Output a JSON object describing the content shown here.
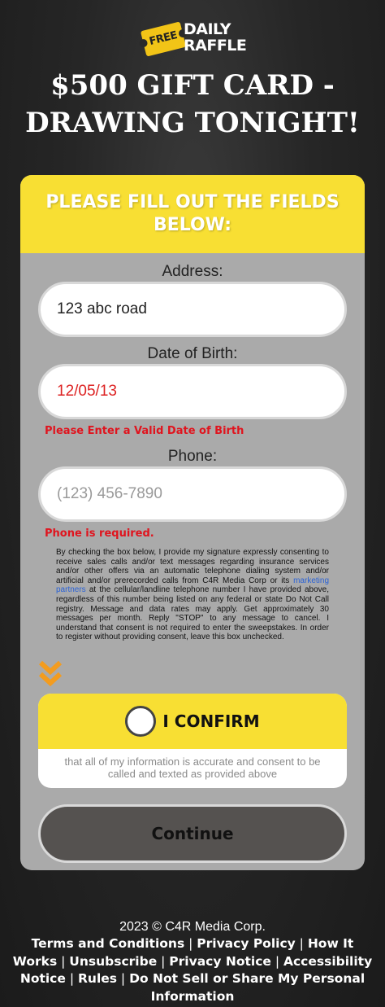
{
  "logo": {
    "free": "FREE",
    "line1": "DAILY",
    "line2": "RAFFLE"
  },
  "headline": {
    "line1": "$500 GIFT CARD -",
    "line2": "DRAWING TONIGHT!"
  },
  "form": {
    "header": "PLEASE FILL OUT THE FIELDS BELOW:",
    "address": {
      "label": "Address:",
      "value": "123 abc road"
    },
    "dob": {
      "label": "Date of Birth:",
      "value": "12/05/13",
      "error": "Please Enter a Valid Date of Birth"
    },
    "phone": {
      "label": "Phone:",
      "value": "",
      "placeholder": "(123) 456-7890",
      "error": "Phone is required."
    },
    "consent": {
      "before": "By checking the box below, I provide my signature expressly consenting to receive sales calls and/or text messages regarding insurance services and/or other offers via an automatic telephone dialing system and/or artificial and/or prerecorded calls from C4R Media Corp or its ",
      "link": "marketing partners",
      "after": " at the cellular/landline telephone number I have provided above, regardless of this number being listed on any federal or state Do Not Call registry. Message and data rates may apply. Get approximately 30 messages per month. Reply \"STOP\" to any message to cancel. I understand that consent is not required to enter the sweepstakes. In order to register without providing consent, leave this box unchecked."
    },
    "confirm": {
      "label": "I CONFIRM",
      "sub": "that all of my information is accurate and consent to be called and texted as provided above",
      "checked": false
    },
    "continue_label": "Continue"
  },
  "footer": {
    "copyright": "2023 © C4R Media Corp.",
    "links": [
      "Terms and Conditions",
      "Privacy Policy",
      "How It Works",
      "Unsubscribe",
      "Privacy Notice",
      "Accessibility Notice",
      "Rules",
      "Do Not Sell or Share My Personal Information"
    ]
  },
  "colors": {
    "accent_yellow": "#f8df33",
    "error_red": "#e0141e",
    "card_gray": "#aaaaaa",
    "button_dark": "#555250",
    "chevron_orange": "#f39c1f"
  }
}
